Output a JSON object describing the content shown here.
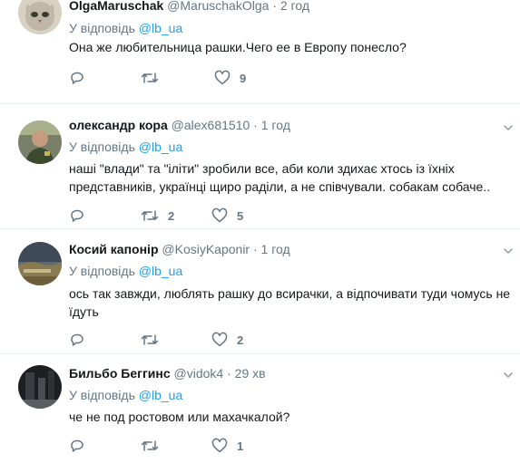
{
  "tweets": [
    {
      "name": "OlgaMaruschak",
      "handle": "@MaruschakOlga",
      "separator": "·",
      "time": "2 год",
      "reply_prefix": "У відповідь",
      "reply_mention": "@lb_ua",
      "text": "Она же любительница рашки.Чего ее в Европу понесло?",
      "replies": "",
      "retweets": "",
      "likes": "9",
      "avatar_icon": "cat-avatar-icon"
    },
    {
      "name": "олександр кора",
      "handle": "@alex681510",
      "separator": "·",
      "time": "1 год",
      "reply_prefix": "У відповідь",
      "reply_mention": "@lb_ua",
      "text": "наші \"влади\" та \"іліти\" зробили все, аби коли здихає хтось із їхніх представників, українці щиро раділи, а не співчували. собакам собаче..",
      "replies": "",
      "retweets": "2",
      "likes": "5",
      "avatar_icon": "person-avatar-icon"
    },
    {
      "name": "Косий капонір",
      "handle": "@KosiyKaponir",
      "separator": "·",
      "time": "1 год",
      "reply_prefix": "У відповідь",
      "reply_mention": "@lb_ua",
      "text": "ось так завжди, люблять рашку до всирачки, а відпочивати туди чомусь не їдуть",
      "replies": "",
      "retweets": "",
      "likes": "2",
      "avatar_icon": "landscape-avatar-icon"
    },
    {
      "name": "Бильбо Беггинс",
      "handle": "@vidok4",
      "separator": "·",
      "time": "29 хв",
      "reply_prefix": "У відповідь",
      "reply_mention": "@lb_ua",
      "text": "че не под ростовом или махачкалой?",
      "replies": "",
      "retweets": "",
      "likes": "1",
      "avatar_icon": "dark-photo-avatar-icon"
    }
  ],
  "colors": {
    "link": "#1da1f2",
    "secondary": "#657786",
    "text": "#14171a",
    "divider": "#e6ecf0"
  }
}
